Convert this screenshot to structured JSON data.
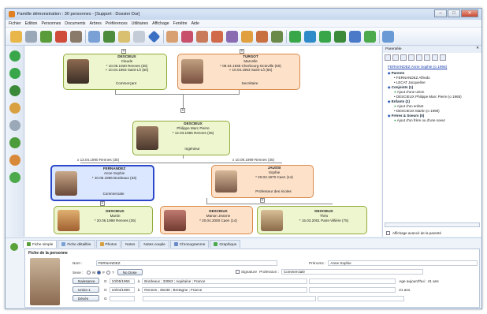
{
  "window": {
    "title": "Famille démonstration : 30 personnes - [Support : Dossier Dur]"
  },
  "menu": [
    "Fichier",
    "Edition",
    "Personnes",
    "Documents",
    "Arbres",
    "Préférences",
    "Utilitaires",
    "Affichage",
    "Fenêtre",
    "Aide"
  ],
  "persons": {
    "gf": {
      "name": "DESCIEUX",
      "first": "Claude",
      "birth": "* 10.05.1930 Rennes (35)",
      "death": "+ 10.04.1963 Saint-Lô (50)",
      "job": "Commerçant"
    },
    "gm": {
      "name": "TURGOT",
      "first": "Marcelle",
      "birth": "* 08.04.1935 Cherbourg-Octeville (50)",
      "death": "+ 10.04.1963 Saint-Lô (50)",
      "job": "Secrétaire"
    },
    "father": {
      "name": "DESCIEUX",
      "first": "Philippe Marc Pierre",
      "birth": "* 12.03.1965 Rennes (35)",
      "job": "Ingénieur"
    },
    "anne": {
      "name": "FERNANDEZ",
      "first": "Anne Sophie",
      "birth": "* 10.05.1966 Bordeaux (33)",
      "job": "Commerciale"
    },
    "sophie": {
      "name": "JAUSSI",
      "first": "Sophie",
      "birth": "* 20.03.1970 Caen (14)",
      "job": "Professeur des écoles"
    },
    "martin": {
      "name": "DESCIEUX",
      "first": "Martin",
      "birth": "* 20.06.1998 Rennes (35)"
    },
    "manon": {
      "name": "DESCIEUX",
      "first": "Manon Jeanne",
      "birth": "* 20.04.2000 Caen (14)"
    },
    "theo": {
      "name": "DESCIEUX",
      "first": "Théo",
      "birth": "* 15.03.2001 Paris-Villière (75)"
    }
  },
  "marriages": {
    "m1": "x 13.04.1990 Rennes (35)",
    "m2": "x 10.09.1999 Rennes (35)"
  },
  "parente": {
    "title": "Parentèle",
    "person": "FERNANDEZ Anne Sophie (o 1966)",
    "parents_h": "Parents",
    "parents": [
      "FERNANDEZ Alfredo",
      "LECAT Jacqueline"
    ],
    "conj_h": "Conjoints (1)",
    "conj_add": "Ajout d'une union",
    "conj": [
      "DESCIEUX Philippe Marc Pierre (o 1965)"
    ],
    "enf_h": "Enfants (1)",
    "enf_add": "Ajout d'un enfant",
    "enf": [
      "DESCIEUX Martin (o 1998)"
    ],
    "fr_h": "Frères & Soeurs (0)",
    "fr_add": "Ajout d'un frère ou d'une soeur",
    "check": "Affichage avancé de la parenté"
  },
  "tabs": [
    "Fiche simple",
    "Fiche détaillée",
    "Photos",
    "Notes",
    "Notes couple",
    "Chronogramme",
    "Graphique"
  ],
  "fiche": {
    "title": "Fiche de la personne",
    "nom_l": "Nom :",
    "nom": "FERNANDEZ",
    "prenoms_l": "Prénoms :",
    "prenoms": "Anne Sophie",
    "sexe_l": "Sexe :",
    "sexe_opts": [
      "M",
      "F",
      "?"
    ],
    "no_dose": "No Dose",
    "signature": "Signature",
    "profession_l": "Profession :",
    "profession": "Commerciale",
    "naissance": "Naissance",
    "union": "Union 1",
    "deces": "Décès",
    "g": "G",
    "n_date": "10/05/1966",
    "n_a": "à",
    "n_place": "Bordeaux ; 33063 ; Aquitaine ; France",
    "u_date": "10/04/1990",
    "u_a": "à",
    "u_place": "Rennes ; 35238 ; Bretagne ; France",
    "age": "Age aujourd'hui : 41 ans",
    "age2": "21 ans"
  }
}
